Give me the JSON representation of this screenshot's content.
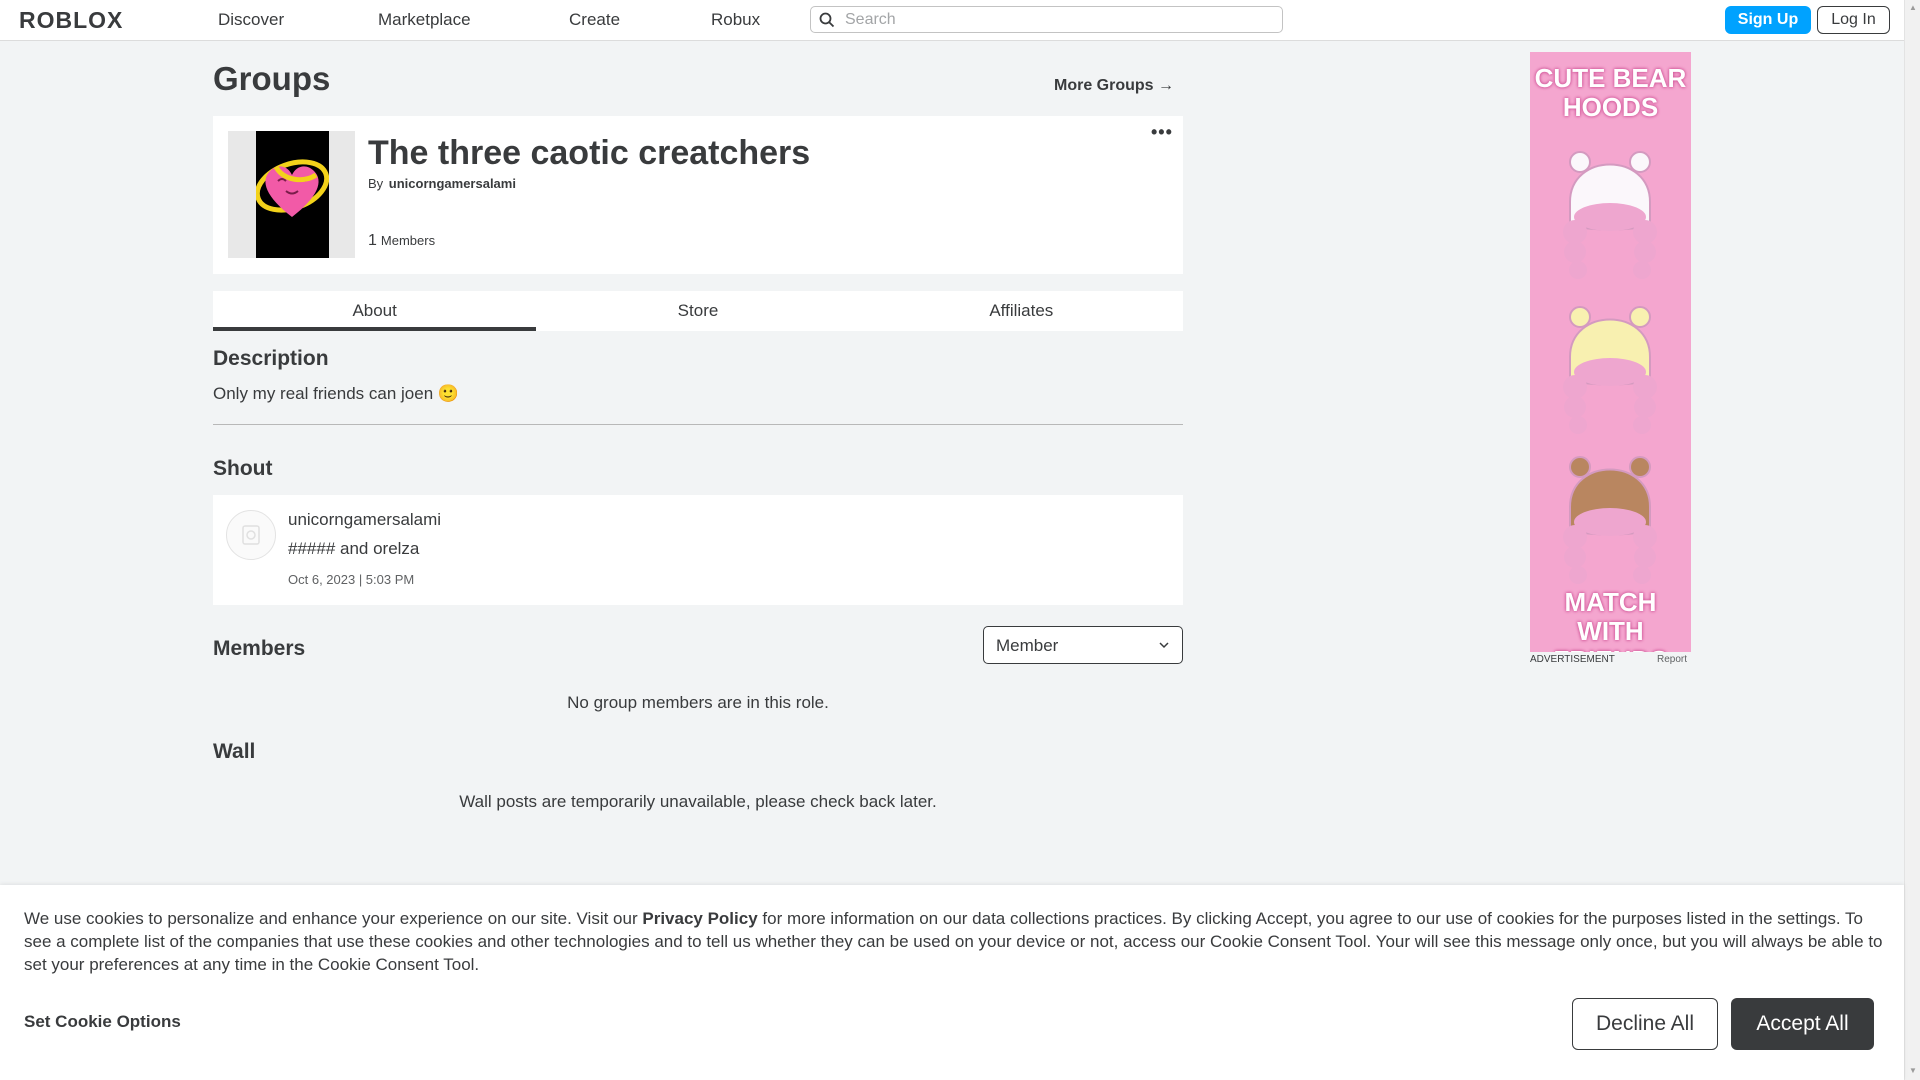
{
  "nav": {
    "logo": "ROBLOX",
    "links": [
      "Discover",
      "Marketplace",
      "Create",
      "Robux"
    ],
    "search_placeholder": "Search",
    "signup_label": "Sign Up",
    "login_label": "Log In",
    "signup_color": "#00a2ff"
  },
  "page": {
    "title": "Groups",
    "more_groups": "More Groups →"
  },
  "group": {
    "name": "The three caotic creatchers",
    "by_label": "By",
    "owner": "unicorngamersalami",
    "member_count": "1",
    "members_label": "Members",
    "menu_icon": "ellipsis-icon"
  },
  "tabs": [
    "About",
    "Store",
    "Affiliates"
  ],
  "active_tab": "About",
  "description": {
    "heading": "Description",
    "text": "Only my real friends can joen 🙂"
  },
  "shout": {
    "heading": "Shout",
    "user": "unicorngamersalami",
    "body": "##### and orelza",
    "date": "Oct 6, 2023 | 5:03 PM"
  },
  "members": {
    "heading": "Members",
    "role_selected": "Member",
    "empty_text": "No group members are in this role."
  },
  "wall": {
    "heading": "Wall",
    "empty_text": "Wall posts are temporarily unavailable, please check back later."
  },
  "ad": {
    "headline": "CUTE BEAR HOODS",
    "tagline": "MATCH WITH FRIENDS",
    "label": "ADVERTISEMENT",
    "report": "Report"
  },
  "cookie": {
    "text_before": "We use cookies to personalize and enhance your experience on our site. Visit our ",
    "link": "Privacy Policy",
    "text_after": " for more information on our data collections practices. By clicking Accept, you agree to our use of cookies for the purposes listed in the settings. To see a complete list of the companies that use these cookies and other technologies and to tell us whether they can be used on your device or not, access our Cookie Consent Tool. Your will see this message only once, but you will always be able to set your preferences at any time in the Cookie Consent Tool.",
    "options_label": "Set Cookie Options",
    "decline_label": "Decline All",
    "accept_label": "Accept All"
  }
}
